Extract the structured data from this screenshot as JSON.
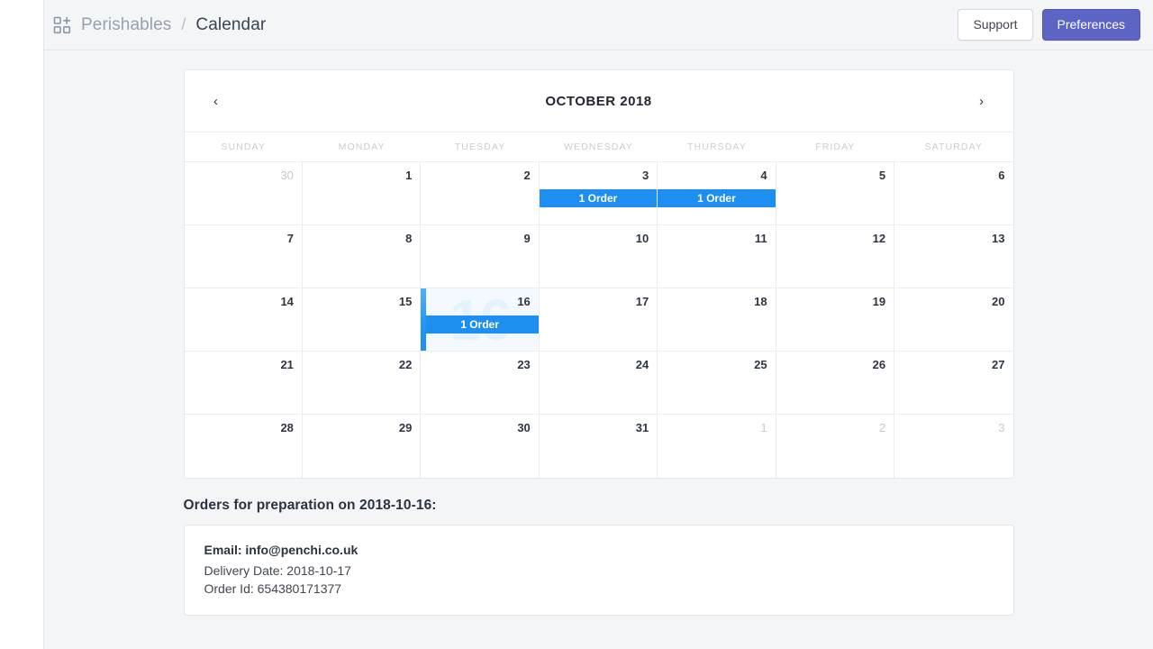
{
  "app": {
    "brand_icon": "grid-add-icon",
    "breadcrumb": {
      "app_name": "Perishables",
      "separator": "/",
      "current": "Calendar"
    },
    "actions": {
      "support_label": "Support",
      "preferences_label": "Preferences"
    }
  },
  "colors": {
    "page_bg": "#f4f5f7",
    "accent_indigo": "#5c65c4",
    "order_blue": "#1f8ef1",
    "selected_bg": "#f3f9fe",
    "text_dark": "#2f3641",
    "text_muted": "#c6cad0"
  },
  "calendar": {
    "title": "OCTOBER 2018",
    "prev_label": "‹",
    "next_label": "›",
    "weekdays": [
      "SUNDAY",
      "MONDAY",
      "TUESDAY",
      "WEDNESDAY",
      "THURSDAY",
      "FRIDAY",
      "SATURDAY"
    ],
    "weeks": [
      [
        {
          "day": "30",
          "muted": true,
          "badge": null,
          "selected": false
        },
        {
          "day": "1",
          "muted": false,
          "badge": null,
          "selected": false
        },
        {
          "day": "2",
          "muted": false,
          "badge": null,
          "selected": false
        },
        {
          "day": "3",
          "muted": false,
          "badge": "1 Order",
          "selected": false
        },
        {
          "day": "4",
          "muted": false,
          "badge": "1 Order",
          "selected": false
        },
        {
          "day": "5",
          "muted": false,
          "badge": null,
          "selected": false
        },
        {
          "day": "6",
          "muted": false,
          "badge": null,
          "selected": false
        }
      ],
      [
        {
          "day": "7",
          "muted": false,
          "badge": null,
          "selected": false
        },
        {
          "day": "8",
          "muted": false,
          "badge": null,
          "selected": false
        },
        {
          "day": "9",
          "muted": false,
          "badge": null,
          "selected": false
        },
        {
          "day": "10",
          "muted": false,
          "badge": null,
          "selected": false
        },
        {
          "day": "11",
          "muted": false,
          "badge": null,
          "selected": false
        },
        {
          "day": "12",
          "muted": false,
          "badge": null,
          "selected": false
        },
        {
          "day": "13",
          "muted": false,
          "badge": null,
          "selected": false
        }
      ],
      [
        {
          "day": "14",
          "muted": false,
          "badge": null,
          "selected": false
        },
        {
          "day": "15",
          "muted": false,
          "badge": null,
          "selected": false
        },
        {
          "day": "16",
          "muted": false,
          "badge": "1 Order",
          "selected": true
        },
        {
          "day": "17",
          "muted": false,
          "badge": null,
          "selected": false
        },
        {
          "day": "18",
          "muted": false,
          "badge": null,
          "selected": false
        },
        {
          "day": "19",
          "muted": false,
          "badge": null,
          "selected": false
        },
        {
          "day": "20",
          "muted": false,
          "badge": null,
          "selected": false
        }
      ],
      [
        {
          "day": "21",
          "muted": false,
          "badge": null,
          "selected": false
        },
        {
          "day": "22",
          "muted": false,
          "badge": null,
          "selected": false
        },
        {
          "day": "23",
          "muted": false,
          "badge": null,
          "selected": false
        },
        {
          "day": "24",
          "muted": false,
          "badge": null,
          "selected": false
        },
        {
          "day": "25",
          "muted": false,
          "badge": null,
          "selected": false
        },
        {
          "day": "26",
          "muted": false,
          "badge": null,
          "selected": false
        },
        {
          "day": "27",
          "muted": false,
          "badge": null,
          "selected": false
        }
      ],
      [
        {
          "day": "28",
          "muted": false,
          "badge": null,
          "selected": false
        },
        {
          "day": "29",
          "muted": false,
          "badge": null,
          "selected": false
        },
        {
          "day": "30",
          "muted": false,
          "badge": null,
          "selected": false
        },
        {
          "day": "31",
          "muted": false,
          "badge": null,
          "selected": false
        },
        {
          "day": "1",
          "muted": true,
          "badge": null,
          "selected": false
        },
        {
          "day": "2",
          "muted": true,
          "badge": null,
          "selected": false
        },
        {
          "day": "3",
          "muted": true,
          "badge": null,
          "selected": false
        }
      ]
    ]
  },
  "orders": {
    "title": "Orders for preparation on 2018-10-16:",
    "items": [
      {
        "email": "Email: info@penchi.co.uk",
        "delivery_date": "Delivery Date: 2018-10-17",
        "order_id": "Order Id: 654380171377"
      }
    ]
  }
}
